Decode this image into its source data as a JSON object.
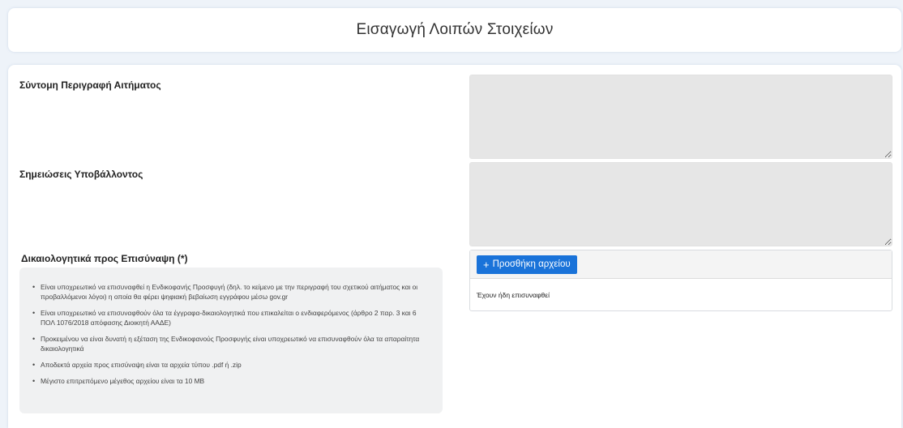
{
  "header": {
    "title": "Εισαγωγή Λοιπών Στοιχείων"
  },
  "form": {
    "short_description_label": "Σύντομη Περιγραφή Αιτήματος",
    "short_description_value": "",
    "notes_label": "Σημειώσεις Υποβάλλοντος",
    "notes_value": "",
    "attachments_label": "Δικαιολογητικά προς Επισύναψη (*)"
  },
  "info": {
    "items": [
      "Είναι υποχρεωτικό να επισυναφθεί η Ενδικοφανής Προσφυγή (δηλ. το κείμενο με την περιγραφή του σχετικού αιτήματος και οι προβαλλόμενοι λόγοι) η οποία θα φέρει ψηφιακή βεβαίωση εγγράφου μέσω gov.gr",
      "Είναι υποχρεωτικό να επισυναφθούν όλα τα έγγραφα-δικαιολογητικά που επικαλείται ο ενδιαφερόμενος (άρθρο 2 παρ. 3 και 6 ΠΟΛ 1076/2018 απόφασης Διοικητή ΑΑΔΕ)",
      "Προκειμένου να είναι δυνατή η εξέταση της Ενδικοφανούς Προσφυγής είναι υποχρεωτικό να επισυναφθούν όλα τα απαραίτητα δικαιολογητικά",
      "Αποδεκτά αρχεία προς επισύναψη είναι τα αρχεία τύπου .pdf ή .zip",
      "Μέγιστο επιτρεπόμενο μέγεθος αρχείου είναι τα 10 MB"
    ],
    "bullet": "•"
  },
  "upload": {
    "plus": "+",
    "add_button_label": "Προσθήκη αρχείου",
    "status": "Έχουν ήδη επισυναφθεί"
  },
  "colors": {
    "accent": "#1a73d9",
    "page_bg": "#eef3f9",
    "field_bg": "#e6e6e6",
    "info_bg": "#f0f1f2"
  }
}
